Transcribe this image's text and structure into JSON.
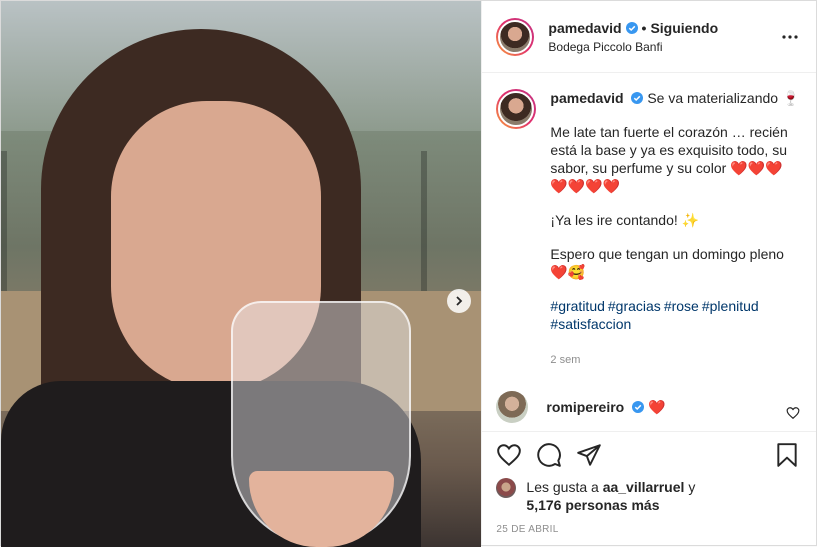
{
  "header": {
    "username": "pamedavid",
    "separator": "•",
    "follow_label": "Siguiendo",
    "location": "Bodega Piccolo Banfi"
  },
  "caption": {
    "username": "pamedavid",
    "first_line": "Se va materializando 🍷",
    "paragraph1": "Me late tan fuerte el corazón … recién está la base y ya es exquisito todo, su sabor, su perfume y su color",
    "hearts1": "❤️❤️❤️ ❤️❤️❤️❤️",
    "paragraph2": "¡Ya les ire contando! ✨",
    "paragraph3": "Espero que tengan un domingo pleno",
    "paragraph3_emoji": "❤️🥰",
    "hashtags": [
      "#gratitud",
      "#gracias",
      "#rose",
      "#plenitud",
      "#satisfaccion"
    ],
    "time": "2 sem"
  },
  "comment": {
    "username": "romipereiro",
    "text": "❤️"
  },
  "likes": {
    "prefix": "Les gusta a",
    "user": "aa_villarruel",
    "middle": "y",
    "count": "5,176 personas más"
  },
  "date": "25 DE ABRIL",
  "icons": {
    "verified": "verified-badge-icon",
    "more": "more-options-icon",
    "like": "heart-icon",
    "comment": "comment-icon",
    "share": "paper-plane-icon",
    "save": "bookmark-icon",
    "next": "chevron-right-icon"
  },
  "colors": {
    "verified_blue": "#3897f0",
    "heart_red": "#e0245e",
    "hashtag_blue": "#00376b",
    "muted_gray": "#8e8e8e"
  }
}
